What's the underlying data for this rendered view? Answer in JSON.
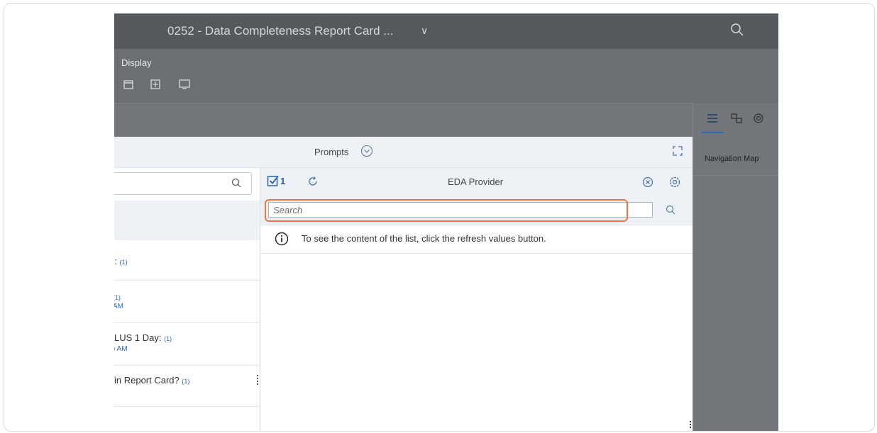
{
  "app": {
    "title": "0252 - Data Completeness Report Card ...",
    "title_chevron": "∨",
    "toolbar_label": "Display"
  },
  "right_panel": {
    "tab_label": "Navigation Map"
  },
  "dialog": {
    "title": "Prompts",
    "left_list": [
      {
        "text": "):",
        "count": "(1)",
        "sub": ""
      },
      {
        "text": "",
        "count": "(1)",
        "sub": "AM"
      },
      {
        "text": "LUS 1 Day:",
        "count": "(1)",
        "sub": ") AM"
      },
      {
        "text": "in Report Card?",
        "count": "(1)",
        "sub": ""
      }
    ],
    "value_panel": {
      "selected_count": "1",
      "title": "EDA Provider",
      "search_placeholder": "Search",
      "info_message": "To see the content of the list, click the refresh values button."
    }
  },
  "colors": {
    "accent": "#2a6ab3",
    "focus_ring": "#f0753a",
    "shell": "#55595e"
  }
}
